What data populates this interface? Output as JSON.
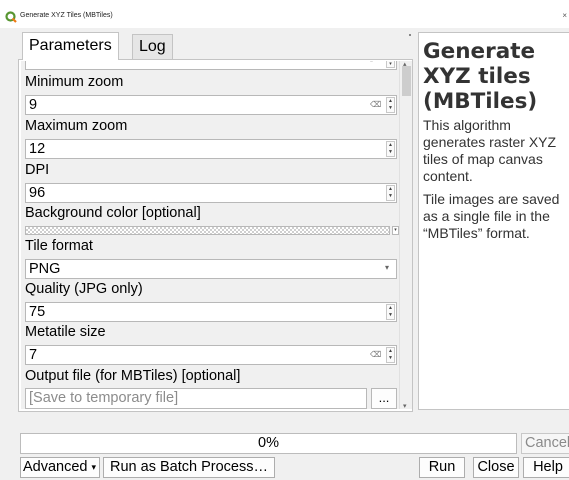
{
  "window": {
    "title": "Generate XYZ Tiles (MBTiles)",
    "close_glyph": "×"
  },
  "tabs": [
    {
      "label": "Parameters",
      "active": true
    },
    {
      "label": "Log",
      "active": false
    }
  ],
  "params": {
    "min_zoom": {
      "label": "Minimum zoom",
      "value": "9"
    },
    "max_zoom": {
      "label": "Maximum zoom",
      "value": "12"
    },
    "dpi": {
      "label": "DPI",
      "value": "96"
    },
    "bg_color": {
      "label": "Background color [optional]"
    },
    "tile_format": {
      "label": "Tile format",
      "value": "PNG"
    },
    "quality": {
      "label": "Quality (JPG only)",
      "value": "75"
    },
    "metatile": {
      "label": "Metatile size",
      "value": "7"
    },
    "output": {
      "label": "Output file (for MBTiles) [optional]",
      "placeholder": "[Save to temporary file]",
      "browse": "..."
    }
  },
  "help": {
    "title": "Generate XYZ tiles (MBTiles)",
    "p1": "This algorithm generates raster XYZ tiles of map canvas content.",
    "p2": "Tile images are saved as a single file in the “MBTiles” format."
  },
  "progress": {
    "text": "0%",
    "value": 0
  },
  "buttons": {
    "cancel": "Cancel",
    "advanced": "Advanced",
    "batch": "Run as Batch Process…",
    "run": "Run",
    "close": "Close",
    "help": "Help"
  },
  "colors": {
    "qgis_icon": "#589632",
    "window_bg": "#f0f0f0",
    "border": "#b8b8b8"
  },
  "icons": [
    "qgis-icon",
    "clear-icon",
    "spin-arrows-icon",
    "dropdown-caret-icon"
  ]
}
